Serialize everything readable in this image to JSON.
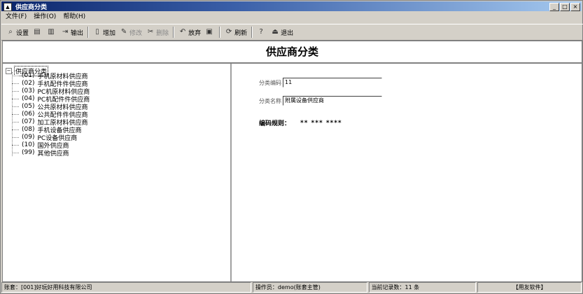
{
  "window": {
    "title": "供应商分类"
  },
  "menu": [
    "文件(F)",
    "操作(O)",
    "帮助(H)"
  ],
  "toolbar": [
    {
      "icon": "magnifier-icon",
      "label": "设置",
      "enabled": true
    },
    {
      "icon": "print-icon",
      "label": "",
      "enabled": true
    },
    {
      "icon": "preview-icon",
      "label": "",
      "enabled": true
    },
    {
      "icon": "export-icon",
      "label": "输出",
      "enabled": true
    },
    {
      "icon": "add-icon",
      "label": "增加",
      "enabled": true
    },
    {
      "icon": "edit-icon",
      "label": "修改",
      "enabled": false
    },
    {
      "icon": "delete-icon",
      "label": "删除",
      "enabled": false
    },
    {
      "icon": "undo-icon",
      "label": "放弃",
      "enabled": true
    },
    {
      "icon": "save-icon",
      "label": "",
      "enabled": true
    },
    {
      "icon": "refresh-icon",
      "label": "刷新",
      "enabled": true
    },
    {
      "icon": "help-icon",
      "label": "",
      "enabled": true
    },
    {
      "icon": "exit-icon",
      "label": "退出",
      "enabled": true
    }
  ],
  "heading": "供应商分类",
  "tree": {
    "root": "供应商分类",
    "nodes": [
      {
        "code": "(01)",
        "name": "手机原材料供应商"
      },
      {
        "code": "(02)",
        "name": "手机配件件供应商"
      },
      {
        "code": "(03)",
        "name": "PC机原材料供应商"
      },
      {
        "code": "(04)",
        "name": "PC机配件件供应商"
      },
      {
        "code": "(05)",
        "name": "公共原材料供应商"
      },
      {
        "code": "(06)",
        "name": "公共配件件供应商"
      },
      {
        "code": "(07)",
        "name": "加工原材料供应商"
      },
      {
        "code": "(08)",
        "name": "手机设备供应商"
      },
      {
        "code": "(09)",
        "name": "PC设备供应商"
      },
      {
        "code": "(10)",
        "name": "国外供应商"
      },
      {
        "code": "(99)",
        "name": "其他供应商"
      }
    ]
  },
  "form": {
    "code_label": "分类编码",
    "code_value": "11",
    "name_label": "分类名称",
    "name_value": "附属设备供应商",
    "rule_label": "编码规则：",
    "rule_value": "** *** ****"
  },
  "status": {
    "account": "账套：[001]好玩好用科技有限公司",
    "operator": "操作员：demo(账套主管)",
    "records": "当前记录数：11 条",
    "brand": "【用友软件】"
  }
}
